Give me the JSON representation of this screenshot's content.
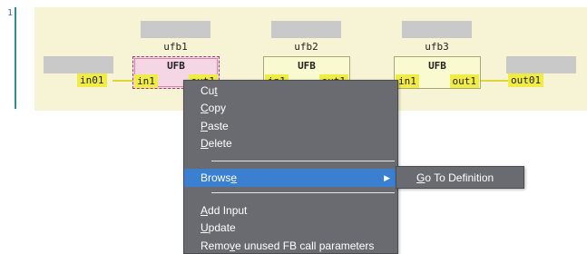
{
  "editor": {
    "line_number": "1"
  },
  "function_blocks": [
    {
      "instance": "ufb1",
      "type": "UFB",
      "input": "in1",
      "output": "out1",
      "selected": true
    },
    {
      "instance": "ufb2",
      "type": "UFB",
      "input": "in1",
      "output": "out1",
      "selected": false
    },
    {
      "instance": "ufb3",
      "type": "UFB",
      "input": "in1",
      "output": "out1",
      "selected": false
    }
  ],
  "variables": {
    "input": "in01",
    "output": "out01"
  },
  "context_menu": {
    "items": [
      {
        "label": "Cut",
        "shortcut_letter": "t"
      },
      {
        "label": "Copy",
        "shortcut_letter": "C"
      },
      {
        "label": "Paste",
        "shortcut_letter": "P"
      },
      {
        "label": "Delete",
        "shortcut_letter": "D"
      },
      {
        "label": "Browse",
        "shortcut_letter": "e",
        "has_submenu": true,
        "highlighted": true
      },
      {
        "label": "Add Input",
        "shortcut_letter": "A"
      },
      {
        "label": "Update",
        "shortcut_letter": "U"
      },
      {
        "label": "Remove unused FB call parameters",
        "shortcut_letter": "v"
      }
    ],
    "submenu": {
      "items": [
        {
          "label": "Go To Definition",
          "shortcut_letter": "G"
        }
      ]
    }
  },
  "colors": {
    "rung_background": "#f6f4d4",
    "port_highlight": "#f0ec44",
    "menu_background": "#6a6b70",
    "menu_highlight": "#3b7fd0",
    "selected_block": "#f4d6e4"
  }
}
